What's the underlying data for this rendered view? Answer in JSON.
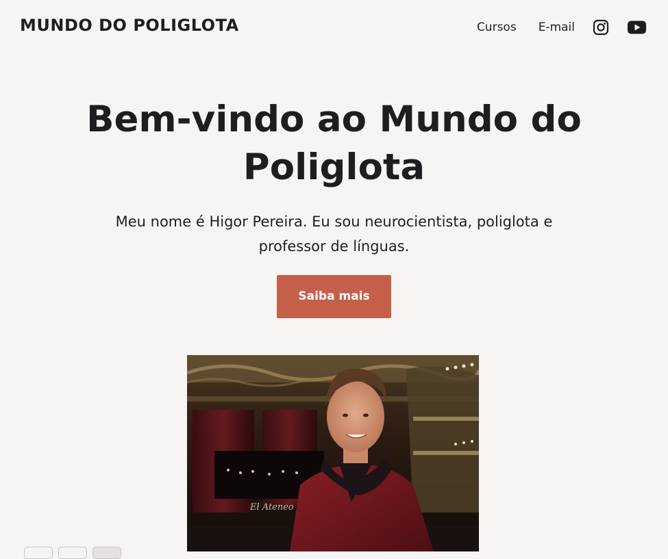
{
  "header": {
    "brand": "MUNDO DO POLIGLOTA",
    "nav": {
      "cursos": "Cursos",
      "email": "E-mail"
    },
    "icons": [
      "instagram-icon",
      "youtube-icon"
    ]
  },
  "hero": {
    "title": "Bem-vindo ao Mundo do Poliglota",
    "subtitle": "Meu nome é Higor Pereira. Eu sou neurocientista, poliglota e professor de línguas.",
    "cta_label": "Saiba mais",
    "cta_color": "#c4604a"
  },
  "photo": {
    "sign_text": "El Ateneo"
  },
  "colors": {
    "background": "#f7f5f4",
    "text": "#1f1d1f",
    "accent": "#c4604a"
  }
}
